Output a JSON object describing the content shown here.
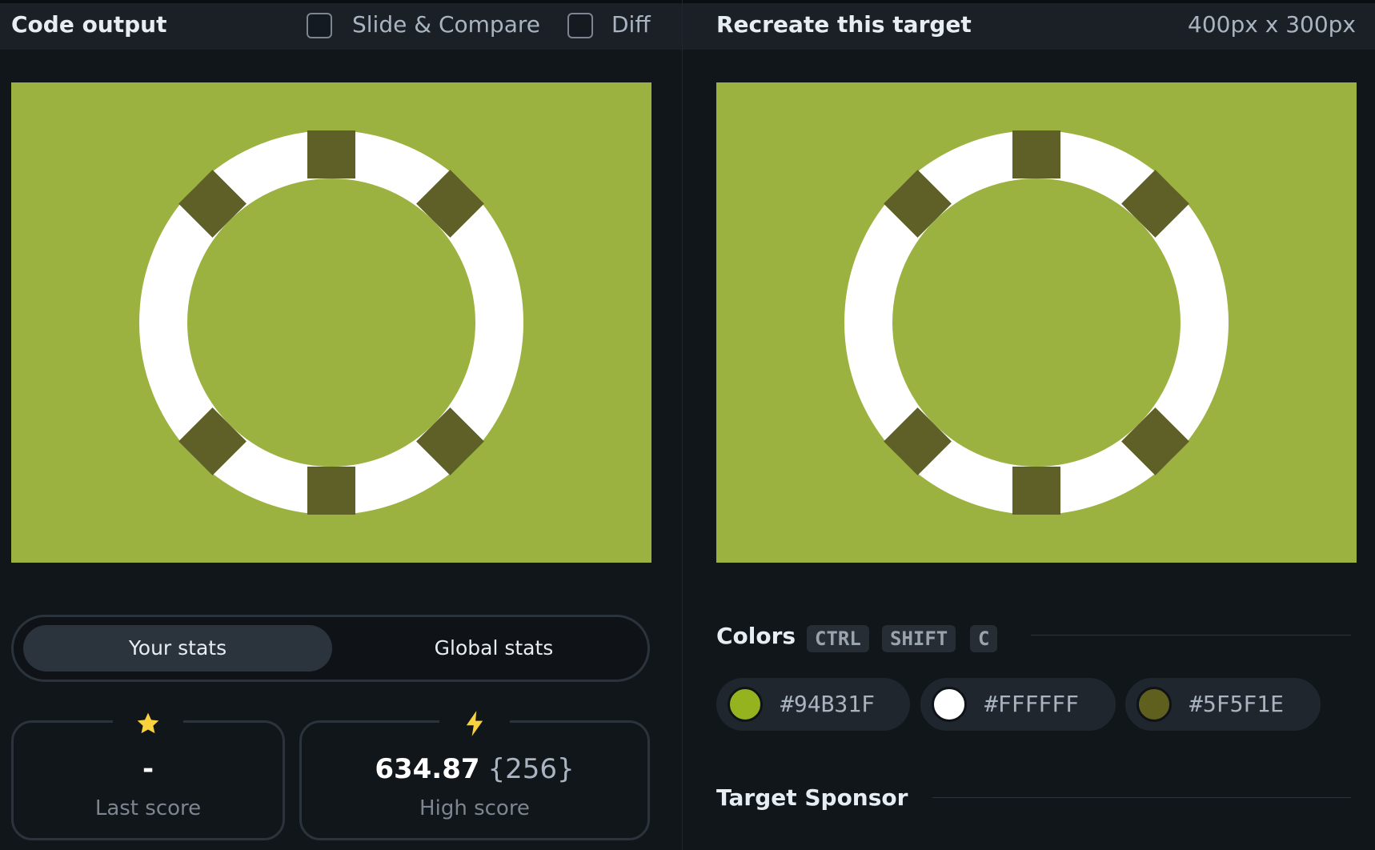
{
  "left": {
    "title": "Code output",
    "slide_compare_label": "Slide & Compare",
    "diff_label": "Diff",
    "stats_tabs": {
      "your": "Your stats",
      "global": "Global stats"
    },
    "last_score": {
      "value": "-",
      "label": "Last score",
      "icon": "star-icon"
    },
    "high_score": {
      "value": "634.87",
      "chars": "{256}",
      "label": "High score",
      "icon": "lightning-icon"
    }
  },
  "right": {
    "title": "Recreate this target",
    "size": "400px x 300px",
    "colors_title": "Colors",
    "shortcut_keys": [
      "CTRL",
      "SHIFT",
      "C"
    ],
    "colors": [
      "#94B31F",
      "#FFFFFF",
      "#5F5F1E"
    ],
    "sponsor_title": "Target Sponsor"
  },
  "theme": {
    "canvas_bg": "#9BB240",
    "ring": "#FFFFFF",
    "segments": "#5F5F28",
    "star": "#F8D23C"
  }
}
